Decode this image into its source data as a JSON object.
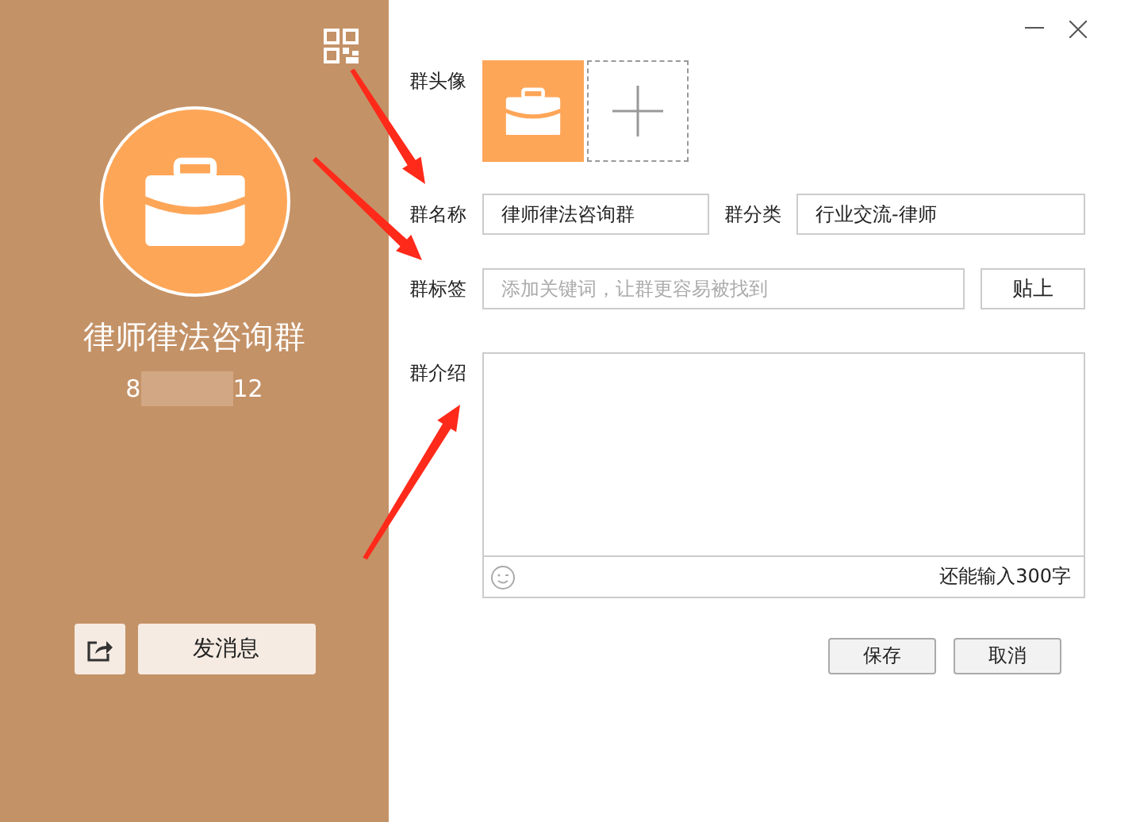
{
  "sidebar": {
    "group_name": "律师律法咨询群",
    "id_prefix": "8",
    "id_suffix": "12",
    "send_button": "发消息"
  },
  "form": {
    "avatar_label": "群头像",
    "name_label": "群名称",
    "name_value": "律师律法咨询群",
    "category_label": "群分类",
    "category_value": "行业交流-律师",
    "tags_label": "群标签",
    "tags_placeholder": "添加关键词，让群更容易被找到",
    "paste_button": "贴上",
    "intro_label": "群介绍",
    "intro_counter": "还能输入300字"
  },
  "buttons": [
    {
      "label": "保存"
    },
    {
      "label": "取消"
    }
  ]
}
